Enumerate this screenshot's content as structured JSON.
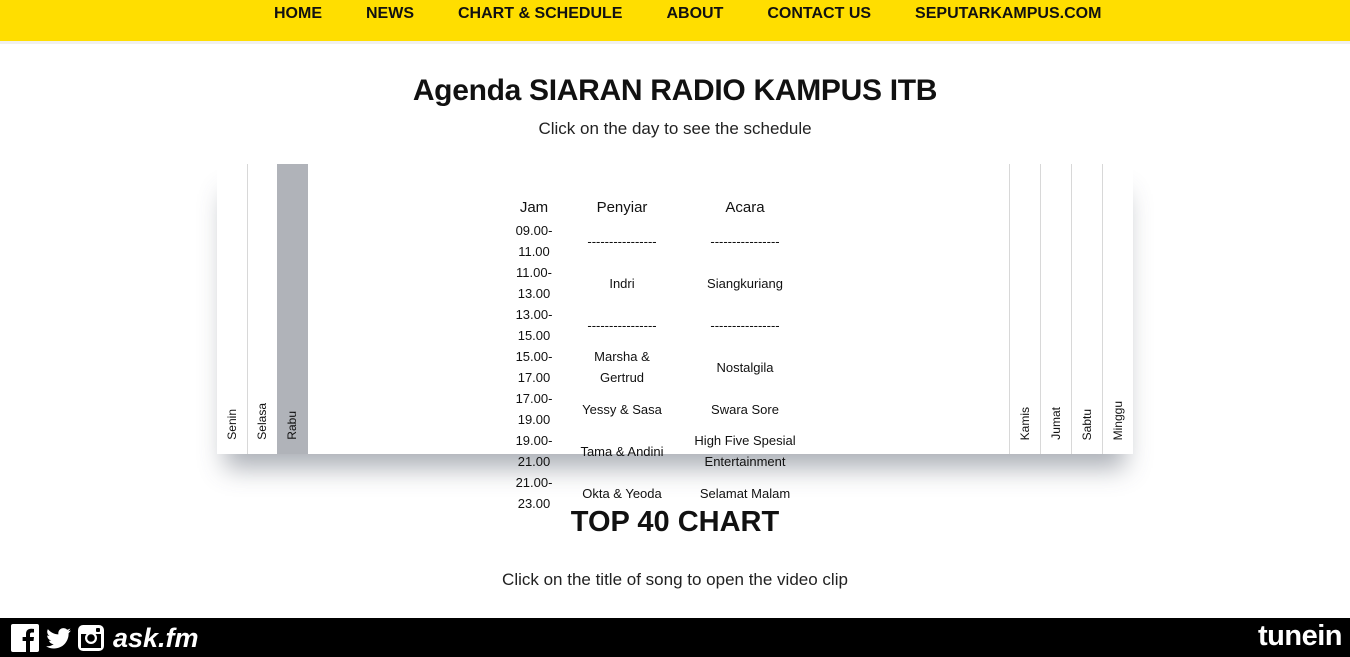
{
  "nav": {
    "items": [
      "HOME",
      "NEWS",
      "CHART & SCHEDULE",
      "ABOUT",
      "CONTACT US",
      "SEPUTARKAMPUS.COM"
    ]
  },
  "agenda": {
    "title": "Agenda SIARAN RADIO KAMPUS ITB",
    "subtitle": "Click on the day to see the schedule",
    "days_left": [
      "Senin",
      "Selasa",
      "Rabu"
    ],
    "days_right": [
      "Kamis",
      "Jumat",
      "Sabtu",
      "Minggu"
    ],
    "active_day": "Rabu",
    "headers": {
      "jam": "Jam",
      "penyiar": "Penyiar",
      "acara": "Acara"
    },
    "rows": [
      {
        "jam": "09.00-11.00",
        "penyiar": "----------------",
        "acara": "----------------"
      },
      {
        "jam": "11.00-13.00",
        "penyiar": "Indri",
        "acara": "Siangkuriang"
      },
      {
        "jam": "13.00-15.00",
        "penyiar": "----------------",
        "acara": "----------------"
      },
      {
        "jam": "15.00-17.00",
        "penyiar": "Marsha & Gertrud",
        "acara": "Nostalgila"
      },
      {
        "jam": "17.00-19.00",
        "penyiar": "Yessy & Sasa",
        "acara": "Swara Sore"
      },
      {
        "jam": "19.00-21.00",
        "penyiar": "Tama & Andini",
        "acara": "High Five Spesial Entertainment"
      },
      {
        "jam": "21.00-23.00",
        "penyiar": "Okta & Yeoda",
        "acara": "Selamat Malam"
      }
    ]
  },
  "chart": {
    "title": "TOP 40 CHART",
    "subtitle": "Click on the title of song to open the video clip"
  },
  "footer": {
    "social_icons": [
      "facebook-icon",
      "twitter-icon",
      "instagram-icon"
    ],
    "askfm": "ask.fm",
    "tunein": "tunein"
  },
  "colors": {
    "nav_bg": "#ffde00",
    "active_tab": "#b0b3b9",
    "footer_bg": "#000000"
  }
}
